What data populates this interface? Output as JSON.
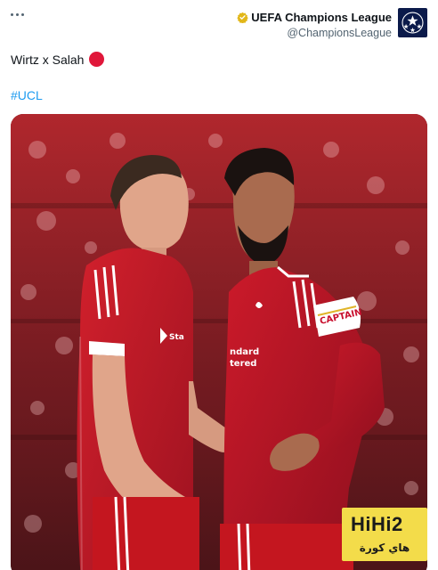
{
  "account": {
    "display_name": "UEFA Champions League",
    "handle": "@ChampionsLeague",
    "verified": true
  },
  "tweet": {
    "text": "Wirtz x Salah",
    "emoji": "red-circle",
    "hashtag": "#UCL"
  },
  "media": {
    "type": "photo",
    "shirt_texts": [
      "Standard Chartered",
      "CAPTAIN"
    ]
  },
  "watermark": {
    "brand_latin": "HiHi2",
    "brand_arabic": "هاي كورة"
  },
  "icons": {
    "more": "more-options-icon",
    "verified": "verified-badge-icon",
    "avatar": "champions-league-starball-icon"
  },
  "colors": {
    "accent_link": "#1d9bf0",
    "text_primary": "#0f1419",
    "text_secondary": "#536471",
    "verified_gold": "#e2b719",
    "liverpool_red": "#c8102e",
    "watermark_yellow": "#f3dc4a"
  }
}
